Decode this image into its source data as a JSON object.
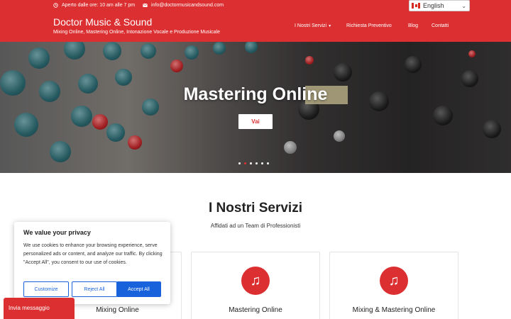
{
  "topbar": {
    "hours": "Aperto dalle ore: 10 am alle 7 pm",
    "email": "info@doctormusicandsound.com",
    "language": "English"
  },
  "header": {
    "brand": "Doctor Music & Sound",
    "tagline": "Mixing Online, Mastering Online, Intonazione Vocale e Produzione Musicale",
    "nav": [
      "I Nostri Servizi",
      "Richiesta Preventivo",
      "Blog",
      "Contatti"
    ]
  },
  "hero": {
    "title": "Mastering Online",
    "button": "Vai",
    "slides_total": 6,
    "active_slide": 2
  },
  "services": {
    "title": "I Nostri Servizi",
    "subtitle": "Affidati ad un Team di Professionisti",
    "cards": [
      "Mixing Online",
      "Mastering Online",
      "Mixing & Mastering Online"
    ]
  },
  "cookie": {
    "title": "We value your privacy",
    "text": "We use cookies to enhance your browsing experience, serve personalized ads or content, and analyze our traffic. By clicking \"Accept All\", you consent to our use of cookies.",
    "customize": "Customize",
    "reject": "Reject All",
    "accept": "Accept All"
  },
  "chat": {
    "label": "Invia messaggio"
  },
  "colors": {
    "brand_red": "#dc2f31",
    "cookie_blue": "#1863dc"
  }
}
